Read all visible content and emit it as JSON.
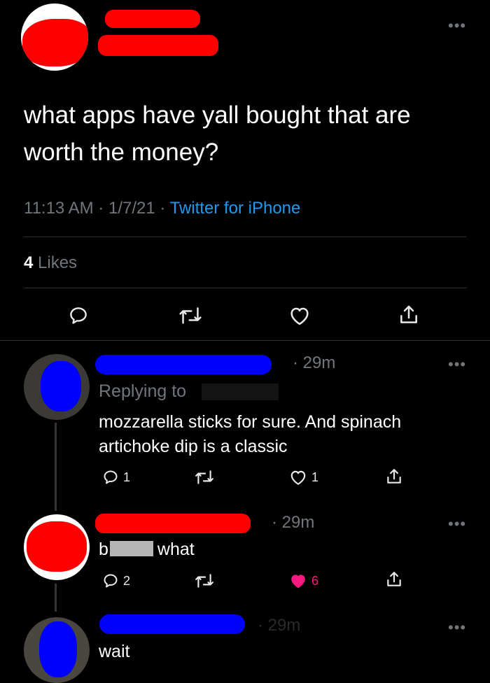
{
  "main_tweet": {
    "more": "•••",
    "text": "what apps have yall bought that are worth the money?",
    "time": "11:13 AM",
    "date": "1/7/21",
    "source": "Twitter for iPhone",
    "likes_count": "4",
    "likes_label": "Likes"
  },
  "replies": [
    {
      "time": "29m",
      "replying_to_label": "Replying to",
      "text": "mozzarella sticks for sure. And spinach artichoke dip is a classic",
      "reply_count": "1",
      "like_count": "1",
      "liked": false,
      "more": "•••"
    },
    {
      "time": "29m",
      "text_before": "b",
      "text_after": "what",
      "reply_count": "2",
      "like_count": "6",
      "liked": true,
      "more": "•••"
    },
    {
      "time": "29m",
      "text": "wait",
      "more": "•••"
    }
  ],
  "colors": {
    "background": "#000000",
    "text": "#ffffff",
    "secondary": "#71767b",
    "link": "#1d9bf0",
    "like_active": "#f91880",
    "redaction_red": "#ff0000",
    "redaction_blue": "#0000ff"
  }
}
